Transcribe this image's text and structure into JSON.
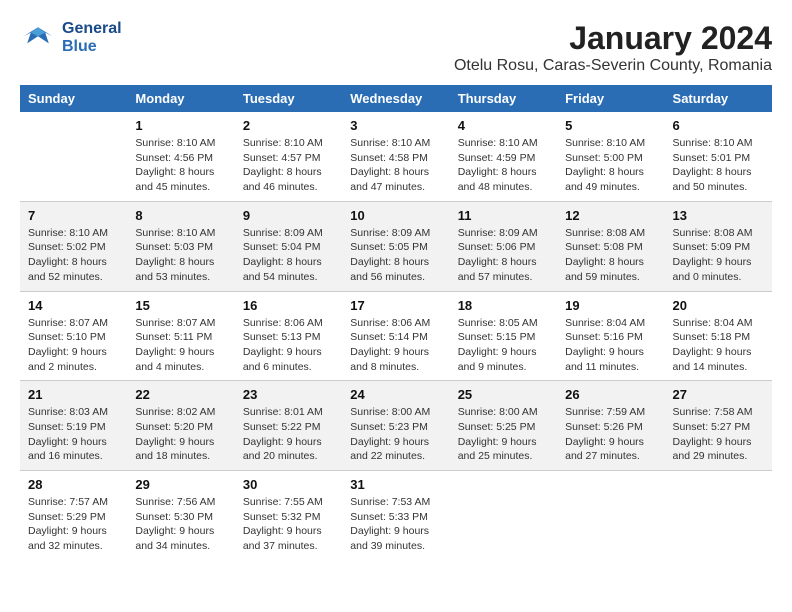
{
  "header": {
    "logo_line1": "General",
    "logo_line2": "Blue",
    "month": "January 2024",
    "location": "Otelu Rosu, Caras-Severin County, Romania"
  },
  "weekdays": [
    "Sunday",
    "Monday",
    "Tuesday",
    "Wednesday",
    "Thursday",
    "Friday",
    "Saturday"
  ],
  "weeks": [
    [
      {
        "day": "",
        "info": ""
      },
      {
        "day": "1",
        "info": "Sunrise: 8:10 AM\nSunset: 4:56 PM\nDaylight: 8 hours\nand 45 minutes."
      },
      {
        "day": "2",
        "info": "Sunrise: 8:10 AM\nSunset: 4:57 PM\nDaylight: 8 hours\nand 46 minutes."
      },
      {
        "day": "3",
        "info": "Sunrise: 8:10 AM\nSunset: 4:58 PM\nDaylight: 8 hours\nand 47 minutes."
      },
      {
        "day": "4",
        "info": "Sunrise: 8:10 AM\nSunset: 4:59 PM\nDaylight: 8 hours\nand 48 minutes."
      },
      {
        "day": "5",
        "info": "Sunrise: 8:10 AM\nSunset: 5:00 PM\nDaylight: 8 hours\nand 49 minutes."
      },
      {
        "day": "6",
        "info": "Sunrise: 8:10 AM\nSunset: 5:01 PM\nDaylight: 8 hours\nand 50 minutes."
      }
    ],
    [
      {
        "day": "7",
        "info": "Sunrise: 8:10 AM\nSunset: 5:02 PM\nDaylight: 8 hours\nand 52 minutes."
      },
      {
        "day": "8",
        "info": "Sunrise: 8:10 AM\nSunset: 5:03 PM\nDaylight: 8 hours\nand 53 minutes."
      },
      {
        "day": "9",
        "info": "Sunrise: 8:09 AM\nSunset: 5:04 PM\nDaylight: 8 hours\nand 54 minutes."
      },
      {
        "day": "10",
        "info": "Sunrise: 8:09 AM\nSunset: 5:05 PM\nDaylight: 8 hours\nand 56 minutes."
      },
      {
        "day": "11",
        "info": "Sunrise: 8:09 AM\nSunset: 5:06 PM\nDaylight: 8 hours\nand 57 minutes."
      },
      {
        "day": "12",
        "info": "Sunrise: 8:08 AM\nSunset: 5:08 PM\nDaylight: 8 hours\nand 59 minutes."
      },
      {
        "day": "13",
        "info": "Sunrise: 8:08 AM\nSunset: 5:09 PM\nDaylight: 9 hours\nand 0 minutes."
      }
    ],
    [
      {
        "day": "14",
        "info": "Sunrise: 8:07 AM\nSunset: 5:10 PM\nDaylight: 9 hours\nand 2 minutes."
      },
      {
        "day": "15",
        "info": "Sunrise: 8:07 AM\nSunset: 5:11 PM\nDaylight: 9 hours\nand 4 minutes."
      },
      {
        "day": "16",
        "info": "Sunrise: 8:06 AM\nSunset: 5:13 PM\nDaylight: 9 hours\nand 6 minutes."
      },
      {
        "day": "17",
        "info": "Sunrise: 8:06 AM\nSunset: 5:14 PM\nDaylight: 9 hours\nand 8 minutes."
      },
      {
        "day": "18",
        "info": "Sunrise: 8:05 AM\nSunset: 5:15 PM\nDaylight: 9 hours\nand 9 minutes."
      },
      {
        "day": "19",
        "info": "Sunrise: 8:04 AM\nSunset: 5:16 PM\nDaylight: 9 hours\nand 11 minutes."
      },
      {
        "day": "20",
        "info": "Sunrise: 8:04 AM\nSunset: 5:18 PM\nDaylight: 9 hours\nand 14 minutes."
      }
    ],
    [
      {
        "day": "21",
        "info": "Sunrise: 8:03 AM\nSunset: 5:19 PM\nDaylight: 9 hours\nand 16 minutes."
      },
      {
        "day": "22",
        "info": "Sunrise: 8:02 AM\nSunset: 5:20 PM\nDaylight: 9 hours\nand 18 minutes."
      },
      {
        "day": "23",
        "info": "Sunrise: 8:01 AM\nSunset: 5:22 PM\nDaylight: 9 hours\nand 20 minutes."
      },
      {
        "day": "24",
        "info": "Sunrise: 8:00 AM\nSunset: 5:23 PM\nDaylight: 9 hours\nand 22 minutes."
      },
      {
        "day": "25",
        "info": "Sunrise: 8:00 AM\nSunset: 5:25 PM\nDaylight: 9 hours\nand 25 minutes."
      },
      {
        "day": "26",
        "info": "Sunrise: 7:59 AM\nSunset: 5:26 PM\nDaylight: 9 hours\nand 27 minutes."
      },
      {
        "day": "27",
        "info": "Sunrise: 7:58 AM\nSunset: 5:27 PM\nDaylight: 9 hours\nand 29 minutes."
      }
    ],
    [
      {
        "day": "28",
        "info": "Sunrise: 7:57 AM\nSunset: 5:29 PM\nDaylight: 9 hours\nand 32 minutes."
      },
      {
        "day": "29",
        "info": "Sunrise: 7:56 AM\nSunset: 5:30 PM\nDaylight: 9 hours\nand 34 minutes."
      },
      {
        "day": "30",
        "info": "Sunrise: 7:55 AM\nSunset: 5:32 PM\nDaylight: 9 hours\nand 37 minutes."
      },
      {
        "day": "31",
        "info": "Sunrise: 7:53 AM\nSunset: 5:33 PM\nDaylight: 9 hours\nand 39 minutes."
      },
      {
        "day": "",
        "info": ""
      },
      {
        "day": "",
        "info": ""
      },
      {
        "day": "",
        "info": ""
      }
    ]
  ]
}
